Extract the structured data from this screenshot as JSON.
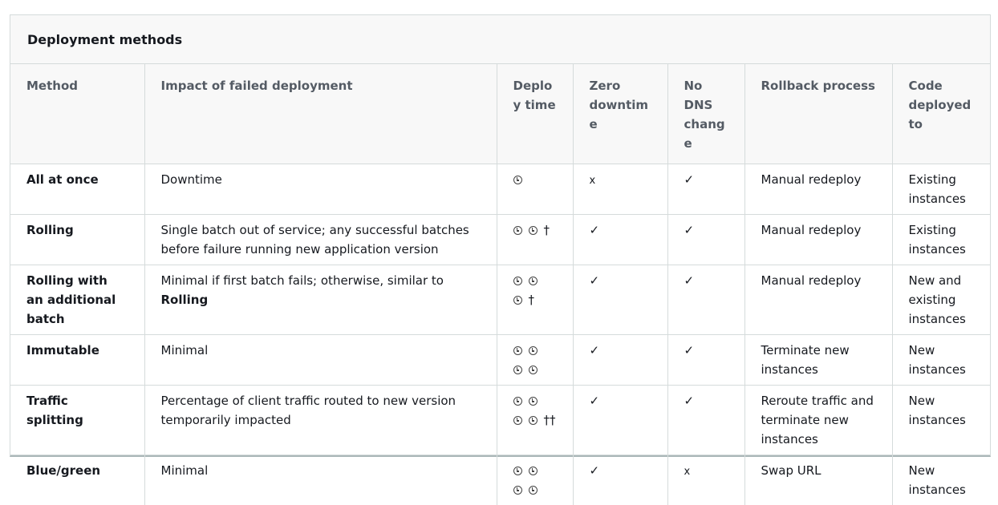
{
  "caption": "Deployment methods",
  "headers": {
    "method": "Method",
    "impact": "Impact of failed deployment",
    "deploy_time": "Deploy time",
    "zero_downtime": "Zero downtime",
    "no_dns": "No DNS change",
    "rollback": "Rollback process",
    "code_deployed": "Code deployed to"
  },
  "icons": {
    "clock": "clock-icon",
    "check": "✓",
    "cross": "x",
    "dagger": "†",
    "double_dagger": "††"
  },
  "rows": [
    {
      "method": "All at once",
      "impact": "Downtime",
      "impact_bold": "",
      "clocks": 1,
      "dagger": "",
      "zero_downtime": "x",
      "no_dns": "✓",
      "rollback": "Manual redeploy",
      "code_deployed": "Existing instances"
    },
    {
      "method": "Rolling",
      "impact": "Single batch out of service; any successful batches before failure running new application version",
      "impact_bold": "",
      "clocks": 2,
      "dagger": "†",
      "zero_downtime": "✓",
      "no_dns": "✓",
      "rollback": "Manual redeploy",
      "code_deployed": "Existing instances"
    },
    {
      "method": "Rolling with an additional batch",
      "impact": "Minimal if first batch fails; otherwise, similar to ",
      "impact_bold": "Rolling",
      "clocks": 3,
      "dagger": "†",
      "zero_downtime": "✓",
      "no_dns": "✓",
      "rollback": "Manual redeploy",
      "code_deployed": "New and existing instances"
    },
    {
      "method": "Immutable",
      "impact": "Minimal",
      "impact_bold": "",
      "clocks": 4,
      "dagger": "",
      "zero_downtime": "✓",
      "no_dns": "✓",
      "rollback": "Terminate new instances",
      "code_deployed": "New instances"
    },
    {
      "method": "Traffic splitting",
      "impact": "Percentage of client traffic routed to new version temporarily impacted",
      "impact_bold": "",
      "clocks": 4,
      "dagger": "††",
      "zero_downtime": "✓",
      "no_dns": "✓",
      "rollback": "Reroute traffic and terminate new instances",
      "code_deployed": "New instances"
    },
    {
      "method": "Blue/green",
      "impact": "Minimal",
      "impact_bold": "",
      "clocks": 4,
      "dagger": "",
      "zero_downtime": "✓",
      "no_dns": "x",
      "rollback": "Swap URL",
      "code_deployed": "New instances"
    }
  ]
}
